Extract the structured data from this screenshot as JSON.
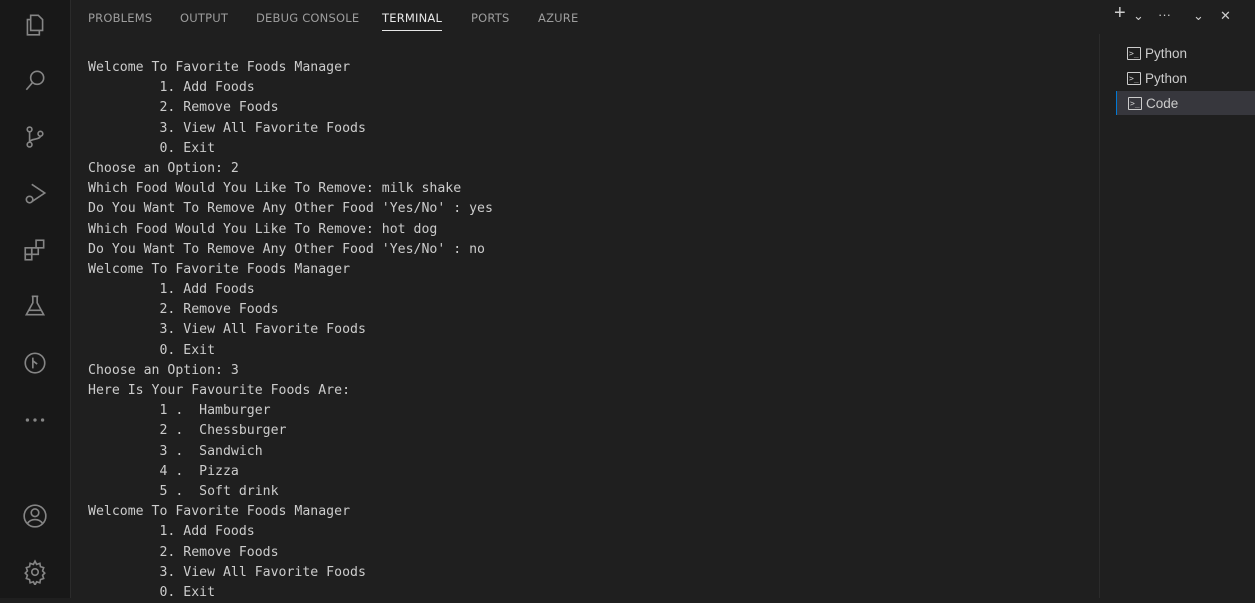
{
  "panel": {
    "tabs": [
      "PROBLEMS",
      "OUTPUT",
      "DEBUG CONSOLE",
      "TERMINAL",
      "PORTS",
      "AZURE"
    ],
    "active_tab": "TERMINAL"
  },
  "toolbar": {
    "new_terminal": "+",
    "dropdown": "⌄",
    "more": "···",
    "collapse": "⌄",
    "close": "✕"
  },
  "terminal": {
    "lines": [
      "Welcome To Favorite Foods Manager",
      "         1. Add Foods",
      "         2. Remove Foods",
      "         3. View All Favorite Foods",
      "         0. Exit",
      "Choose an Option: 2",
      "Which Food Would You Like To Remove: milk shake",
      "Do You Want To Remove Any Other Food 'Yes/No' : yes",
      "Which Food Would You Like To Remove: hot dog",
      "Do You Want To Remove Any Other Food 'Yes/No' : no",
      "Welcome To Favorite Foods Manager",
      "         1. Add Foods",
      "         2. Remove Foods",
      "         3. View All Favorite Foods",
      "         0. Exit",
      "Choose an Option: 3",
      "Here Is Your Favourite Foods Are:",
      "         1 .  Hamburger",
      "         2 .  Chessburger",
      "         3 .  Sandwich",
      "         4 .  Pizza",
      "         5 .  Soft drink",
      "Welcome To Favorite Foods Manager",
      "         1. Add Foods",
      "         2. Remove Foods",
      "         3. View All Favorite Foods",
      "         0. Exit"
    ]
  },
  "sessions": [
    {
      "label": "Python",
      "active": false
    },
    {
      "label": "Python",
      "active": false
    },
    {
      "label": "Code",
      "active": true
    }
  ],
  "activity_bar": {
    "icons": [
      "explorer-icon",
      "search-icon",
      "source-control-icon",
      "run-debug-icon",
      "extensions-icon",
      "testing-icon",
      "git-graph-icon",
      "more-icon",
      "account-icon",
      "settings-gear-icon"
    ]
  },
  "colors": {
    "background": "#1f1f1f",
    "activity_bar": "#181818",
    "accent": "#0078d4",
    "text": "#cccccc"
  }
}
